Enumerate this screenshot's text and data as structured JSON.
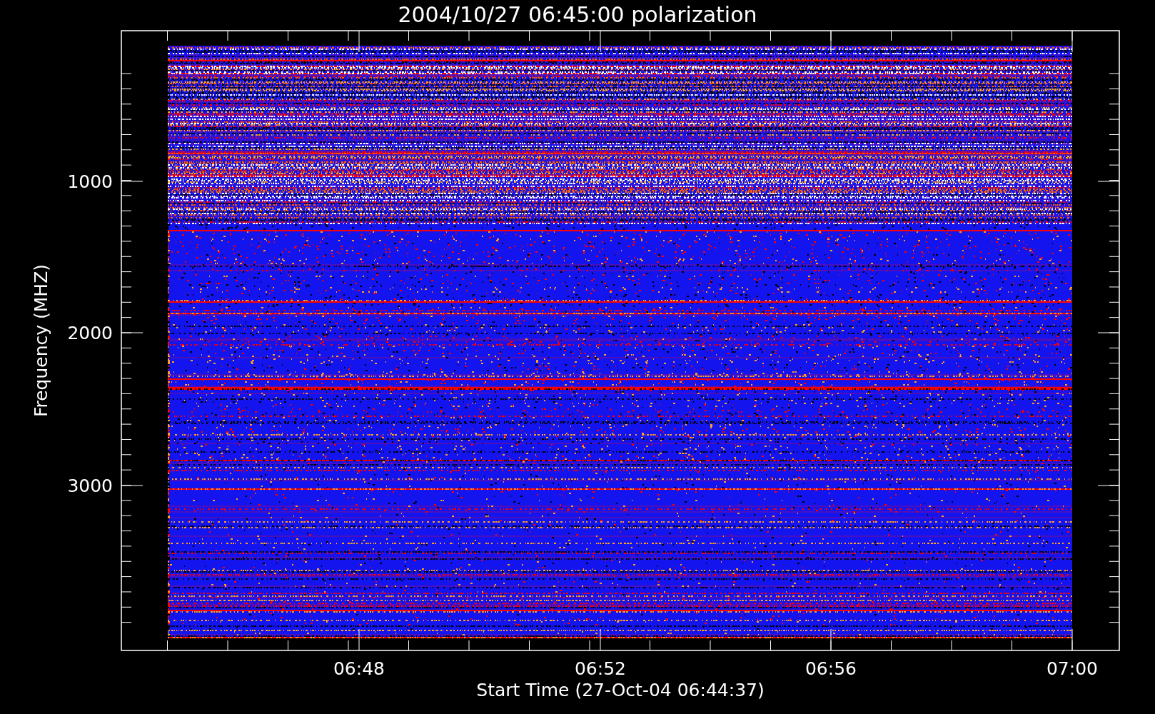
{
  "title": "2004/10/27 06:45:00 polarization",
  "y_axis": {
    "label": "Frequency (MHZ)",
    "ticks": [
      "1000",
      "2000",
      "3000"
    ]
  },
  "x_axis": {
    "label": "Start Time (27-Oct-04 06:44:37)",
    "ticks": [
      "06:48",
      "06:52",
      "06:56",
      "07:00"
    ]
  }
}
